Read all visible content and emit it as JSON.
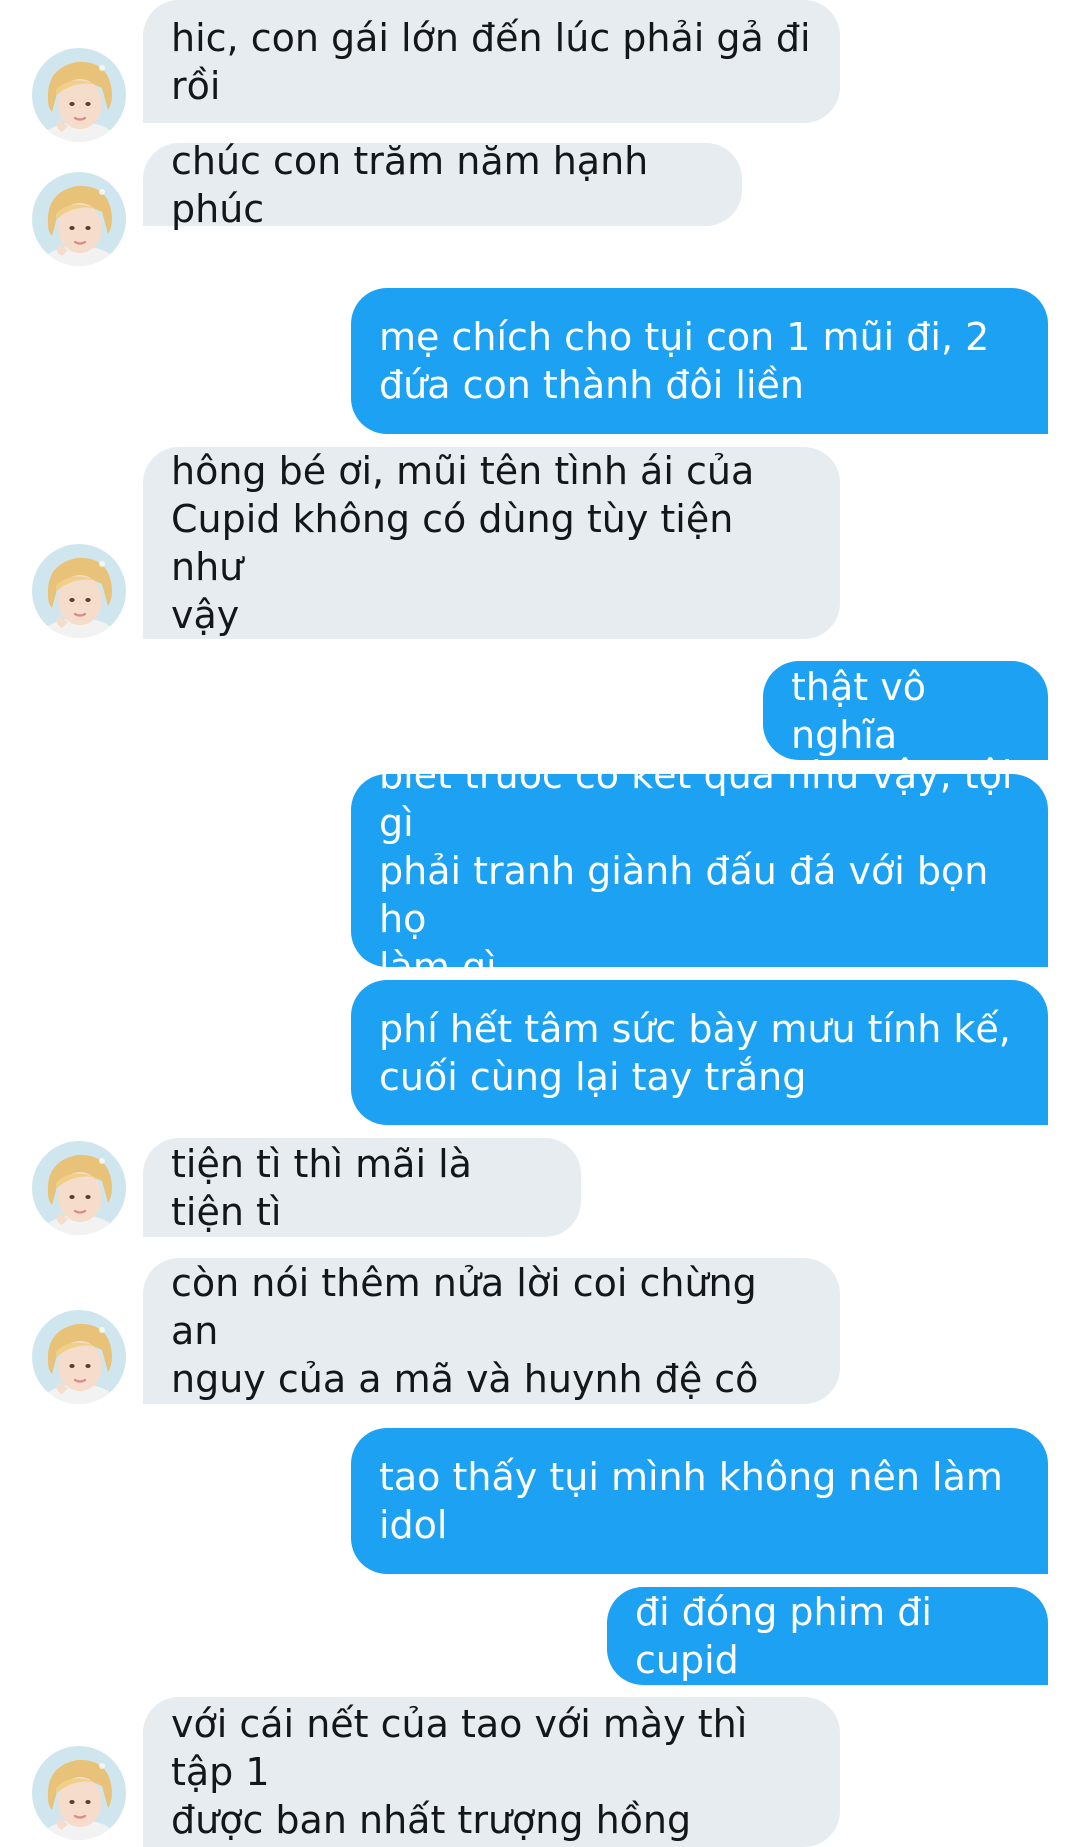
{
  "conversation": {
    "messages": [
      {
        "sender": "them",
        "text": "hic, con gái lớn đến lúc phải gả đi\nrồi"
      },
      {
        "sender": "them",
        "text": "chúc con trăm năm hạnh phúc"
      },
      {
        "sender": "me",
        "text": "mẹ chích cho tụi con 1 mũi đi, 2\nđứa con thành đôi liền"
      },
      {
        "sender": "them",
        "text": "hông bé ơi, mũi tên tình ái của\nCupid không có dùng tùy tiện như\nvậy"
      },
      {
        "sender": "me",
        "text": "thật vô nghĩa"
      },
      {
        "sender": "me",
        "text": "biết trước có kết quả như vậy, tội gì\nphải tranh giành đấu đá với bọn họ\nlàm gì"
      },
      {
        "sender": "me",
        "text": "phí hết tâm sức bày mưu tính kế,\ncuối cùng lại tay trắng"
      },
      {
        "sender": "them",
        "text": "tiện tì thì mãi là tiện tì"
      },
      {
        "sender": "them",
        "text": "còn nói thêm nửa lời coi chừng an\nnguy của a mã và huynh đệ cô"
      },
      {
        "sender": "me",
        "text": "tao thấy tụi mình không nên làm\nidol"
      },
      {
        "sender": "me",
        "text": "đi đóng phim đi cupid"
      },
      {
        "sender": "them",
        "text": "với cái nết của tao với mày thì tập 1\nđược ban nhất trượng hồng"
      }
    ]
  },
  "colors": {
    "incoming_bubble": "#e6ecf0",
    "outgoing_bubble": "#1da1f2",
    "incoming_text": "#14171a",
    "outgoing_text": "#ffffff"
  },
  "icons": {
    "avatar": "avatar-photo-icon"
  }
}
